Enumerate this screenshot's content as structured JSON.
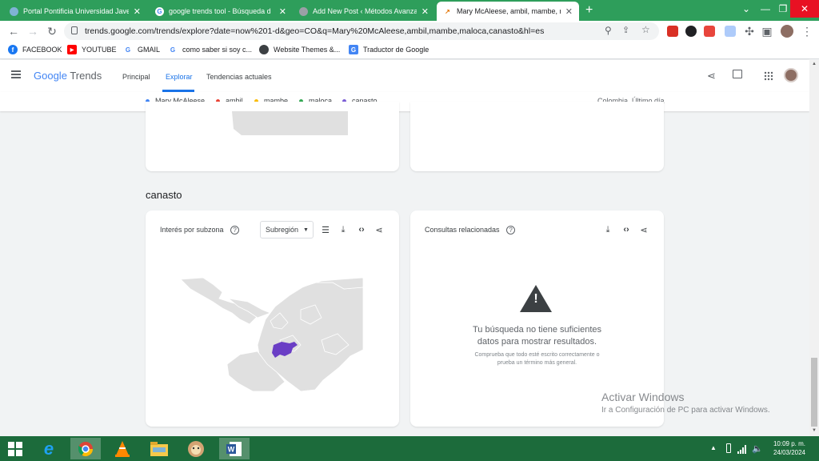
{
  "browser": {
    "tabs": [
      {
        "title": "Portal Pontificia Universidad Jave",
        "active": false
      },
      {
        "title": "google trends tool - Búsqueda d",
        "active": false
      },
      {
        "title": "Add New Post ‹ Métodos Avanza",
        "active": false
      },
      {
        "title": "Mary McAleese, ambil, mambe, n",
        "active": true
      }
    ],
    "new_tab_label": "+",
    "window_controls": {
      "dropdown": "⌄",
      "minimize": "—",
      "restore": "❐",
      "close": "✕"
    },
    "url": "trends.google.com/trends/explore?date=now%201-d&geo=CO&q=Mary%20McAleese,ambil,mambe,maloca,canasto&hl=es",
    "bookmarks": [
      {
        "label": "FACEBOOK",
        "icon": "facebook-icon"
      },
      {
        "label": "YOUTUBE",
        "icon": "youtube-icon"
      },
      {
        "label": "GMAIL",
        "icon": "google-icon"
      },
      {
        "label": "como saber si soy c...",
        "icon": "google-icon"
      },
      {
        "label": "Website Themes &...",
        "icon": "globe-icon"
      },
      {
        "label": "Traductor de Google",
        "icon": "translate-icon"
      }
    ]
  },
  "trends": {
    "logo_google": "Google",
    "logo_trends": "Trends",
    "nav": [
      {
        "label": "Principal",
        "active": false
      },
      {
        "label": "Explorar",
        "active": true
      },
      {
        "label": "Tendencias actuales",
        "active": false
      }
    ],
    "terms": [
      {
        "label": "Mary McAleese",
        "color": "#4285f4"
      },
      {
        "label": "ambil",
        "color": "#ea4335"
      },
      {
        "label": "mambe",
        "color": "#fbbc04"
      },
      {
        "label": "maloca",
        "color": "#34a853"
      },
      {
        "label": "canasto",
        "color": "#7b5dd6"
      }
    ],
    "scope": "Colombia, Último día",
    "section_title": "canasto",
    "interest_card": {
      "title": "Interés por subzona",
      "help": "?",
      "dropdown_value": "Subregión",
      "region_color": "#6a3ec5"
    },
    "related_card": {
      "title": "Consultas relacionadas",
      "help": "?",
      "warning_glyph": "!",
      "message_line1": "Tu búsqueda no tiene suficientes",
      "message_line2": "datos para mostrar resultados.",
      "hint_line1": "Comprueba que todo esté escrito correctamente o",
      "hint_line2": "prueba un término más general."
    }
  },
  "watermark": {
    "title": "Activar Windows",
    "subtitle": "Ir a Configuración de PC para activar Windows."
  },
  "taskbar": {
    "time": "10:09 p. m.",
    "date": "24/03/2024"
  }
}
